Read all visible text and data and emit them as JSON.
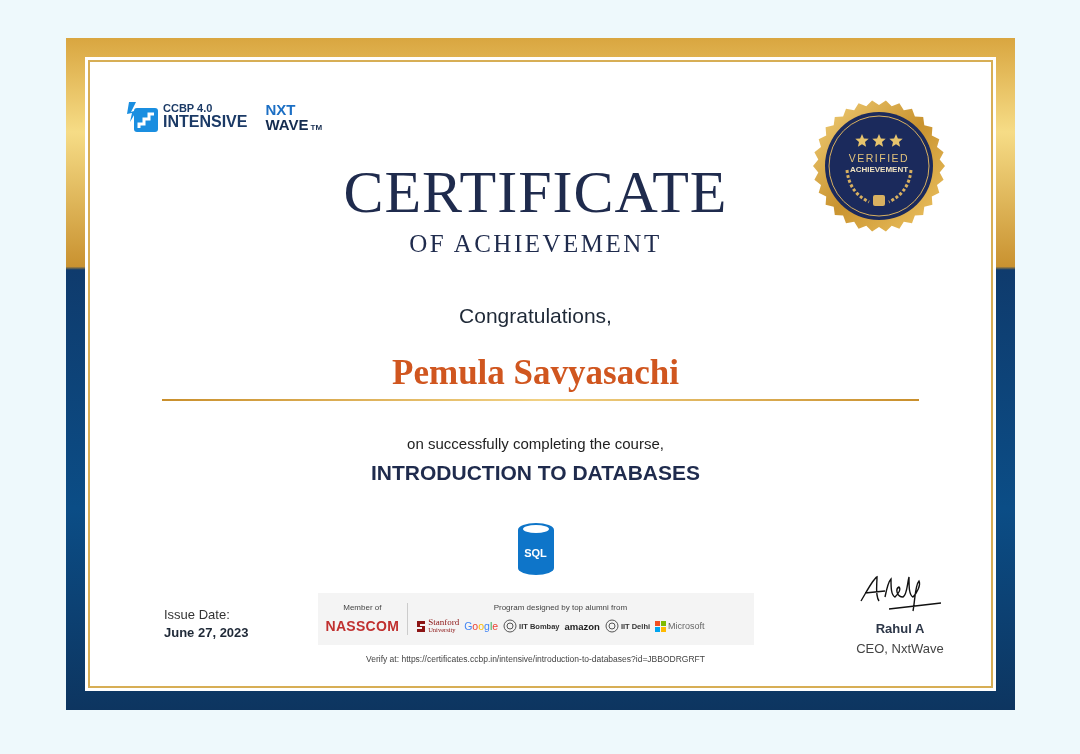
{
  "branding": {
    "program_logo": {
      "line_1": "CCBP 4.0",
      "line_2": "INTENSIVE"
    },
    "company_logo": {
      "line_1": "NXT",
      "line_2": "WAVE",
      "mark": "TM"
    }
  },
  "seal": {
    "line_1": "VERIFIED",
    "line_2": "ACHIEVEMENT",
    "stars": 3
  },
  "title": "CERTIFICATE",
  "subtitle": "OF ACHIEVEMENT",
  "greeting": "Congratulations,",
  "recipient": "Pemula Savyasachi",
  "intro": "on successfully completing the course,",
  "course": "INTRODUCTION TO DATABASES",
  "course_icon": {
    "label": "SQL"
  },
  "issue": {
    "label": "Issue Date:",
    "date": "June 27, 2023"
  },
  "affiliations": {
    "member_label": "Member of",
    "member": "NASSCOM",
    "alumni_label": "Program designed by top alumni from",
    "partners": [
      {
        "kind": "stanford",
        "name": "Stanford",
        "sub": "University"
      },
      {
        "kind": "google",
        "name": "Google"
      },
      {
        "kind": "iit",
        "name": "IIT Bombay"
      },
      {
        "kind": "amazon",
        "name": "amazon"
      },
      {
        "kind": "iit",
        "name": "IIT Delhi"
      },
      {
        "kind": "microsoft",
        "name": "Microsoft"
      }
    ]
  },
  "verify": "Verify at: https://certificates.ccbp.in/intensive/introduction-to-databases?id=JBBODRGRFT",
  "signatory": {
    "name": "Rahul A",
    "role": "CEO, NxtWave"
  }
}
